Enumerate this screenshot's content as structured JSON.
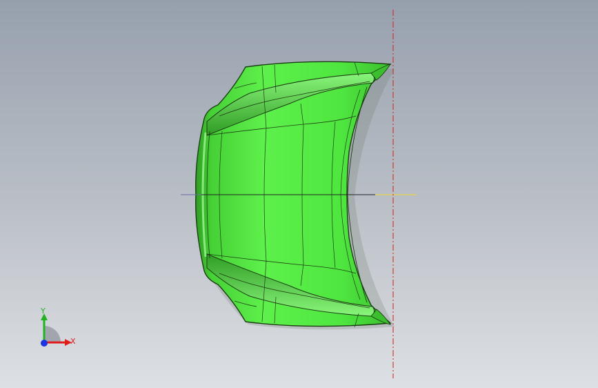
{
  "viewport": {
    "model_color": "#4fe640",
    "model_edge_color": "#1b3d12",
    "mirror_plane_color": "#d22b2b",
    "centerline_color": "#222222"
  },
  "triad": {
    "x_label": "X",
    "y_label": "Y",
    "x_color": "#e21b1b",
    "y_color": "#22b222",
    "z_color": "#1b35e2",
    "x_icon": "x-axis-arrow-icon",
    "y_icon": "y-axis-arrow-icon",
    "z_icon": "z-axis-dot-icon"
  }
}
